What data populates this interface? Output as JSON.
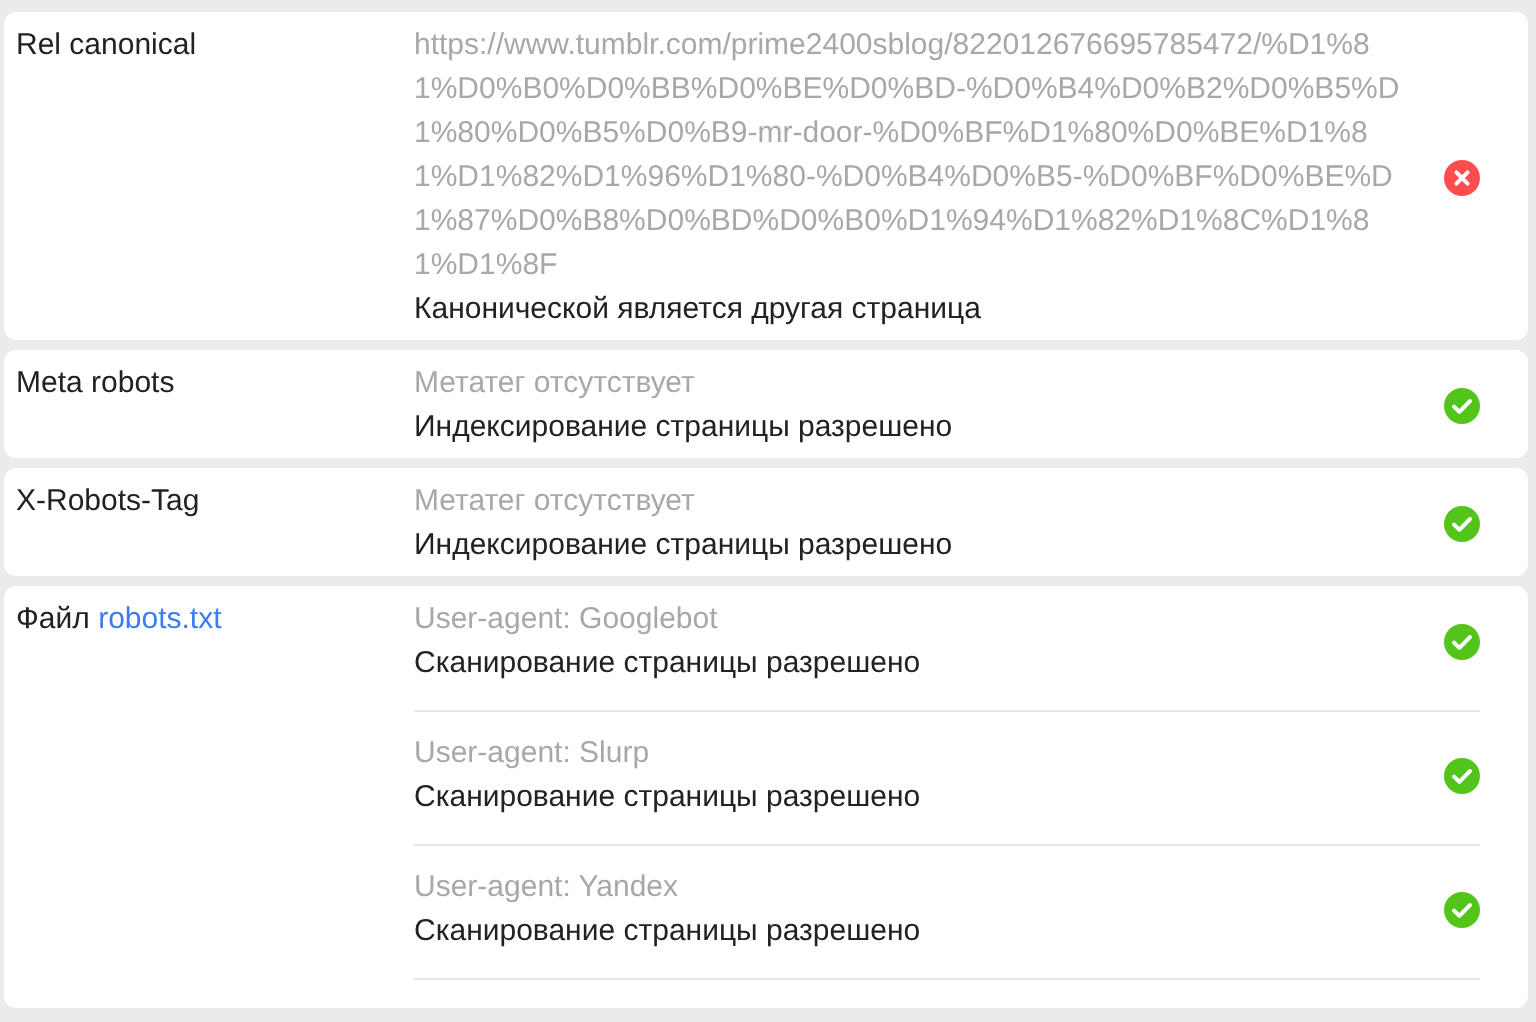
{
  "rows": [
    {
      "label": "Rel canonical",
      "entries": [
        {
          "detail": "https://www.tumblr.com/prime2400sblog/822012676695785472/%D1%81%D0%B0%D0%BB%D0%BE%D0%BD-%D0%B4%D0%B2%D0%B5%D1%80%D0%B5%D0%B9-mr-door-%D0%BF%D1%80%D0%BE%D1%81%D1%82%D1%96%D1%80-%D0%B4%D0%B5-%D0%BF%D0%BE%D1%87%D0%B8%D0%BD%D0%B0%D1%94%D1%82%D1%8C%D1%81%D1%8F",
          "result": "Канонической является другая страница",
          "ok": false
        }
      ]
    },
    {
      "label": "Meta robots",
      "entries": [
        {
          "detail": "Метатег отсутствует",
          "result": "Индексирование страницы разрешено",
          "ok": true
        }
      ]
    },
    {
      "label": "X-Robots-Tag",
      "entries": [
        {
          "detail": "Метатег отсутствует",
          "result": "Индексирование страницы разрешено",
          "ok": true
        }
      ]
    },
    {
      "label": "Файл",
      "link": "robots.txt",
      "entries": [
        {
          "detail": "User-agent: Googlebot",
          "result": "Сканирование страницы разрешено",
          "ok": true
        },
        {
          "detail": "User-agent: Slurp",
          "result": "Сканирование страницы разрешено",
          "ok": true
        },
        {
          "detail": "User-agent: Yandex",
          "result": "Сканирование страницы разрешено",
          "ok": true
        }
      ]
    }
  ]
}
